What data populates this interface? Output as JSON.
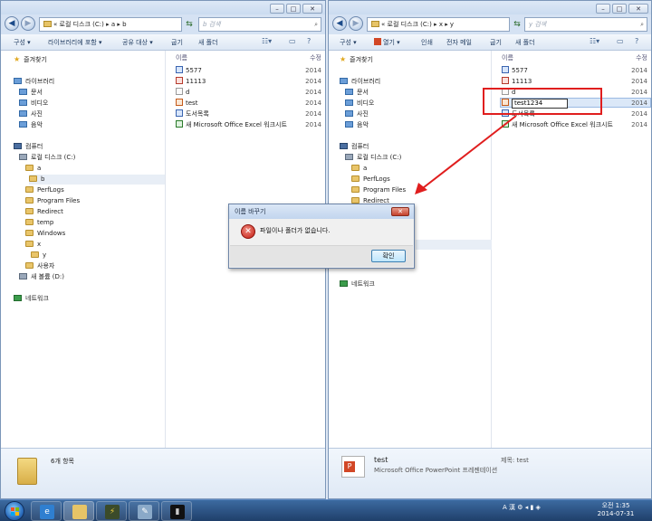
{
  "left_window": {
    "address": "« 로컬 디스크 (C:) ▸ a ▸ b",
    "search_placeholder": "b 검색",
    "toolbar": [
      "구성 ▾",
      "라이브러리에 포함 ▾",
      "공유 대상 ▾",
      "굽기",
      "새 폴더"
    ],
    "tree": [
      {
        "label": "즐겨찾기",
        "icon": "star"
      },
      {
        "label": "라이브러리",
        "icon": "lib"
      },
      {
        "label": "문서",
        "icon": "lib"
      },
      {
        "label": "비디오",
        "icon": "lib"
      },
      {
        "label": "사진",
        "icon": "lib"
      },
      {
        "label": "음악",
        "icon": "lib"
      },
      {
        "label": "컴퓨터",
        "icon": "comp"
      },
      {
        "label": "로컬 디스크 (C:)",
        "icon": "drive"
      },
      {
        "label": "a",
        "icon": "folder"
      },
      {
        "label": "b",
        "icon": "folder"
      },
      {
        "label": "PerfLogs",
        "icon": "folder"
      },
      {
        "label": "Program Files",
        "icon": "folder"
      },
      {
        "label": "Redirect",
        "icon": "folder"
      },
      {
        "label": "temp",
        "icon": "folder"
      },
      {
        "label": "Windows",
        "icon": "folder"
      },
      {
        "label": "x",
        "icon": "folder"
      },
      {
        "label": "y",
        "icon": "folder"
      },
      {
        "label": "사용자",
        "icon": "folder"
      },
      {
        "label": "새 볼륨 (D:)",
        "icon": "drive"
      },
      {
        "label": "네트워크",
        "icon": "net"
      }
    ],
    "col_name": "이름",
    "col_date": "수정",
    "files": [
      {
        "name": "5577",
        "icon": "doc",
        "date": "2014"
      },
      {
        "name": "11113",
        "icon": "pdf",
        "date": "2014"
      },
      {
        "name": "d",
        "icon": "blank",
        "date": "2014"
      },
      {
        "name": "test",
        "icon": "ppt",
        "date": "2014"
      },
      {
        "name": "도서목록",
        "icon": "doc",
        "date": "2014"
      },
      {
        "name": "새 Microsoft Office Excel 워크시트",
        "icon": "xls",
        "date": "2014"
      }
    ],
    "details": {
      "summary": "6개 항목"
    }
  },
  "right_window": {
    "address": "« 로컬 디스크 (C:) ▸ x ▸ y",
    "search_placeholder": "y 검색",
    "toolbar": [
      "구성 ▾",
      "열기 ▾",
      "인쇄",
      "전자 메일",
      "굽기",
      "새 폴더"
    ],
    "tree": [
      {
        "label": "즐겨찾기",
        "icon": "star"
      },
      {
        "label": "라이브러리",
        "icon": "lib"
      },
      {
        "label": "문서",
        "icon": "lib"
      },
      {
        "label": "비디오",
        "icon": "lib"
      },
      {
        "label": "사진",
        "icon": "lib"
      },
      {
        "label": "음악",
        "icon": "lib"
      },
      {
        "label": "컴퓨터",
        "icon": "comp"
      },
      {
        "label": "로컬 디스크 (C:)",
        "icon": "drive"
      },
      {
        "label": "a",
        "icon": "folder"
      },
      {
        "label": "PerfLogs",
        "icon": "folder"
      },
      {
        "label": "Program Files",
        "icon": "folder"
      },
      {
        "label": "Redirect",
        "icon": "folder"
      },
      {
        "label": "네트워크",
        "icon": "net"
      }
    ],
    "col_name": "이름",
    "col_date": "수정",
    "files": [
      {
        "name": "5577",
        "icon": "doc",
        "date": "2014"
      },
      {
        "name": "11113",
        "icon": "pdf",
        "date": "2014"
      },
      {
        "name": "d",
        "icon": "blank",
        "date": "2014"
      },
      {
        "name": "test",
        "icon": "ppt",
        "date": "2014"
      },
      {
        "name": "도서목록",
        "icon": "doc",
        "date": "2014"
      },
      {
        "name": "새 Microsoft Office Excel 워크시트",
        "icon": "xls",
        "date": "2014"
      }
    ],
    "rename_value": "test1234",
    "details": {
      "name": "test",
      "type": "Microsoft Office PowerPoint 프레젠테이션",
      "title_label": "제목: test"
    }
  },
  "dialog": {
    "title": "이름 바꾸기",
    "message": "파일이나 폴더가 없습니다.",
    "ok_label": "확인",
    "close_glyph": "✕"
  },
  "taskbar": {
    "tray": "A 漢 ⚙ ◂ ▮ ◈",
    "time": "오전 1:35",
    "date": "2014-07-31"
  },
  "colors": {
    "annotation_red": "#e01e1e",
    "selection": "#dbe8f8"
  }
}
